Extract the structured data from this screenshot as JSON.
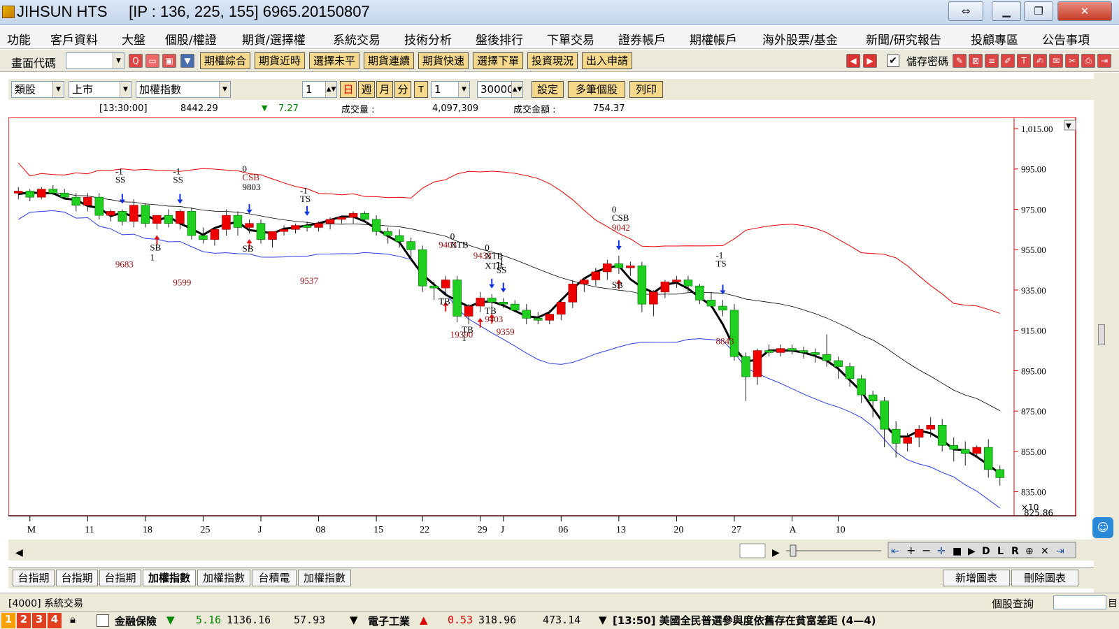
{
  "titlebar": {
    "title": "JIHSUN HTS",
    "ip": "[IP : 136, 225, 155] 6965.20150807"
  },
  "menu": [
    "功能",
    "客戶資料",
    "大盤",
    "個股/權證",
    "期貨/選擇權",
    "系統交易",
    "技術分析",
    "盤後排行",
    "下單交易",
    "證券帳戶",
    "期權帳戶",
    "海外股票/基金",
    "新聞/研究報告",
    "投顧專區",
    "公告事項"
  ],
  "toolbar1": {
    "code_label": "畫面代碼",
    "buttons": [
      "期權綜合",
      "期貨近時",
      "選擇未平",
      "期貨連續",
      "期貨快速",
      "選擇下單",
      "投資現況",
      "出入申請"
    ],
    "save_pw_label": "儲存密碼"
  },
  "toolbar2": {
    "category": "類股",
    "market": "上市",
    "index": "加權指數",
    "period_value": "1",
    "periods": [
      "日",
      "週",
      "月",
      "分",
      "T"
    ],
    "period_count": "1",
    "bars_count": "30000",
    "buttons": [
      "設定",
      "多筆個股",
      "列印"
    ]
  },
  "infobar": {
    "time": "[13:30:00]",
    "price": "8442.29",
    "change": "7.27",
    "volume_label": "成交量 :",
    "volume": "4,097,309",
    "amount_label": "成交金額 :",
    "amount": "754.37"
  },
  "chart_data": {
    "type": "candlestick",
    "ylim": [
      825.86,
      1015.0
    ],
    "y_ticks": [
      1015.0,
      995.0,
      975.0,
      955.0,
      935.0,
      915.0,
      895.0,
      875.0,
      855.0,
      835.0
    ],
    "y_tick_labels": [
      "1,015.00",
      "995.00",
      "975.00",
      "955.00",
      "935.00",
      "915.00",
      "895.00",
      "875.00",
      "855.00",
      "835.00"
    ],
    "y_bottom_label": "825.86",
    "y_scale_label": "×10",
    "x_labels": [
      "M",
      "11",
      "18",
      "25",
      "J",
      "08",
      "15",
      "22",
      "29",
      "J",
      "06",
      "13",
      "20",
      "27",
      "A",
      "10"
    ],
    "x_label_idx": [
      1,
      6,
      11,
      16,
      21,
      26,
      31,
      35,
      40,
      42,
      47,
      52,
      57,
      62,
      67,
      71
    ],
    "candles": [
      [
        983,
        986,
        980,
        984
      ],
      [
        984,
        985,
        979,
        981
      ],
      [
        981,
        986,
        980,
        985
      ],
      [
        985,
        987,
        982,
        983
      ],
      [
        983,
        985,
        980,
        981
      ],
      [
        981,
        983,
        974,
        977
      ],
      [
        977,
        983,
        974,
        981
      ],
      [
        981,
        983,
        970,
        972
      ],
      [
        972,
        975,
        969,
        974
      ],
      [
        974,
        975,
        967,
        969
      ],
      [
        969,
        980,
        966,
        977
      ],
      [
        977,
        978,
        966,
        968
      ],
      [
        968,
        972,
        965,
        972
      ],
      [
        972,
        975,
        966,
        968
      ],
      [
        968,
        975,
        965,
        974
      ],
      [
        974,
        976,
        960,
        962
      ],
      [
        962,
        966,
        958,
        960
      ],
      [
        960,
        966,
        957,
        965
      ],
      [
        965,
        975,
        962,
        972
      ],
      [
        972,
        974,
        962,
        966
      ],
      [
        966,
        970,
        963,
        968
      ],
      [
        968,
        970,
        958,
        960
      ],
      [
        960,
        964,
        956,
        964
      ],
      [
        964,
        967,
        962,
        965
      ],
      [
        965,
        968,
        963,
        967
      ],
      [
        967,
        969,
        964,
        966
      ],
      [
        966,
        969,
        964,
        968
      ],
      [
        968,
        971,
        965,
        970
      ],
      [
        970,
        972,
        968,
        971
      ],
      [
        971,
        974,
        968,
        973
      ],
      [
        973,
        974,
        969,
        970
      ],
      [
        970,
        972,
        962,
        964
      ],
      [
        964,
        966,
        958,
        962
      ],
      [
        962,
        965,
        956,
        959
      ],
      [
        959,
        961,
        950,
        955
      ],
      [
        955,
        957,
        934,
        937
      ],
      [
        937,
        939,
        930,
        936
      ],
      [
        936,
        942,
        932,
        940
      ],
      [
        940,
        942,
        919,
        922
      ],
      [
        922,
        928,
        918,
        927
      ],
      [
        927,
        934,
        924,
        931
      ],
      [
        931,
        933,
        926,
        929
      ],
      [
        929,
        931,
        926,
        928
      ],
      [
        928,
        930,
        924,
        925
      ],
      [
        925,
        928,
        918,
        921
      ],
      [
        921,
        924,
        918,
        920
      ],
      [
        920,
        925,
        918,
        923
      ],
      [
        923,
        930,
        920,
        929
      ],
      [
        929,
        940,
        926,
        938
      ],
      [
        938,
        941,
        934,
        940
      ],
      [
        940,
        946,
        937,
        944
      ],
      [
        944,
        950,
        940,
        948
      ],
      [
        948,
        952,
        943,
        946
      ],
      [
        946,
        949,
        942,
        947
      ],
      [
        947,
        949,
        924,
        928
      ],
      [
        928,
        935,
        922,
        934
      ],
      [
        934,
        940,
        931,
        939
      ],
      [
        939,
        942,
        936,
        940
      ],
      [
        940,
        942,
        934,
        937
      ],
      [
        937,
        938,
        928,
        930
      ],
      [
        930,
        934,
        926,
        927
      ],
      [
        927,
        930,
        922,
        925
      ],
      [
        925,
        928,
        900,
        902
      ],
      [
        902,
        904,
        880,
        892
      ],
      [
        892,
        906,
        888,
        905
      ],
      [
        905,
        908,
        902,
        904
      ],
      [
        904,
        908,
        902,
        906
      ],
      [
        906,
        908,
        903,
        905
      ],
      [
        905,
        907,
        901,
        904
      ],
      [
        904,
        906,
        899,
        903
      ],
      [
        903,
        913,
        897,
        900
      ],
      [
        900,
        902,
        891,
        897
      ],
      [
        897,
        899,
        887,
        891
      ],
      [
        891,
        893,
        879,
        883
      ],
      [
        883,
        885,
        872,
        880
      ],
      [
        880,
        882,
        857,
        866
      ],
      [
        866,
        870,
        852,
        859
      ],
      [
        859,
        864,
        855,
        862
      ],
      [
        862,
        868,
        857,
        866
      ],
      [
        866,
        872,
        862,
        868
      ],
      [
        868,
        871,
        855,
        858
      ],
      [
        858,
        862,
        850,
        856
      ],
      [
        856,
        860,
        848,
        854
      ],
      [
        854,
        858,
        852,
        857
      ],
      [
        857,
        861,
        842,
        846
      ],
      [
        846,
        848,
        838,
        842
      ]
    ],
    "annotations_text": [
      "-1",
      "SS",
      "SB",
      "1",
      "9683",
      "9599",
      "-1",
      "SS",
      "0",
      "CSB",
      "9803",
      "SB",
      "-1",
      "TS",
      "9537",
      "9403",
      "0",
      "XTB",
      "TB",
      "19390",
      "TB",
      "1",
      "0",
      "XTB",
      "9433",
      "XTB",
      "-1",
      "SS",
      "TB",
      "9403",
      "9359",
      "0",
      "CSB",
      "9042",
      "SB",
      "-1",
      "TS",
      "8843"
    ]
  },
  "tabs": [
    "台指期",
    "台指期",
    "台指期",
    "加權指數",
    "加權指數",
    "台積電",
    "加權指數"
  ],
  "chart_buttons": [
    "新增圖表",
    "刪除圖表"
  ],
  "status1": {
    "screen": "[4000] 系統交易",
    "query_label": "個股查詢",
    "query_tail": "目"
  },
  "status2": {
    "sector1": "金融保險",
    "s1_change": "5.16",
    "s1_value": "1136.16",
    "s1_amount": "57.93",
    "sector2": "電子工業",
    "s2_change": "0.53",
    "s2_value": "318.96",
    "s2_amount": "473.14",
    "news": "[13:50] 美國全民普選參與度依舊存在貧富差距 (4—4)"
  }
}
